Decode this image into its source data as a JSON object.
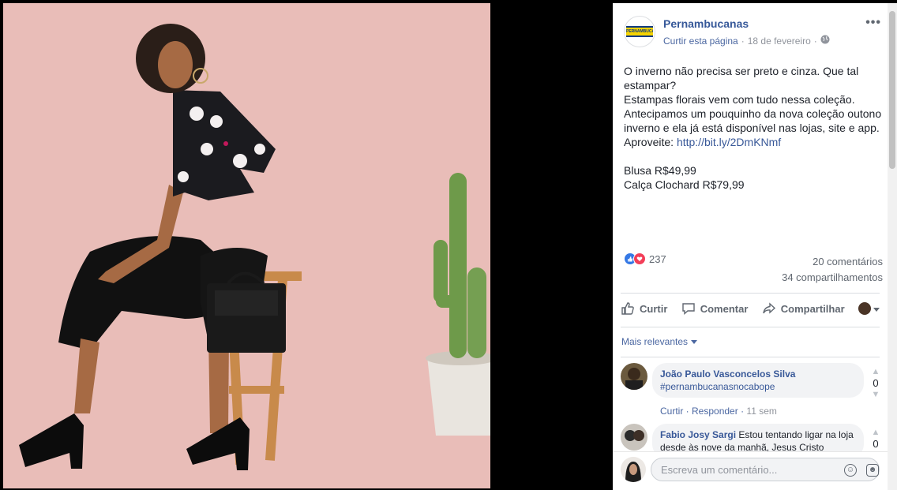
{
  "post": {
    "page_name": "Pernambucanas",
    "logo_text": "PERNAMBUCANAS",
    "like_page": "Curtir esta página",
    "separator": "·",
    "date": "18 de fevereiro",
    "more": "•••",
    "text_lines": [
      "O inverno não precisa ser preto e cinza. Que tal",
      "estampar?",
      "Estampas florais vem com tudo nessa coleção.",
      "Antecipamos um pouquinho da nova coleção outono",
      "inverno e ela já está disponível nas lojas, site e app."
    ],
    "aproveite": "Aproveite: ",
    "link": "http://bit.ly/2DmKNmf",
    "prices": [
      "Blusa R$49,99",
      "Calça Clochard R$79,99"
    ]
  },
  "stats": {
    "reactions": "237",
    "comments": "20 comentários",
    "shares": "34 compartilhamentos"
  },
  "actions": {
    "like": "Curtir",
    "comment": "Comentar",
    "share": "Compartilhar"
  },
  "comments_section": {
    "filter": "Mais relevantes",
    "comments": [
      {
        "author": "João Paulo Vasconcelos Silva",
        "text": "",
        "hashtag": "#pernambucanasnocabope",
        "like": "Curtir",
        "reply": "Responder",
        "time": "11 sem",
        "votes": "0"
      },
      {
        "author": "Fabio Josy Sargi",
        "text": "Estou tentando ligar na loja desde às nove da manhã, Jesus Cristo",
        "votes": "0"
      }
    ],
    "compose_placeholder": "Escreva um comentário..."
  },
  "colors": {
    "link": "#385898",
    "photo_background": "#e9bdb8",
    "like_blue": "#3578e5",
    "love_red": "#f33e58"
  },
  "icons": [
    "globe-icon",
    "like-icon",
    "love-icon",
    "thumbs-up-icon",
    "comment-icon",
    "share-icon",
    "emoji-icon",
    "sticker-icon",
    "caret-down-icon"
  ]
}
